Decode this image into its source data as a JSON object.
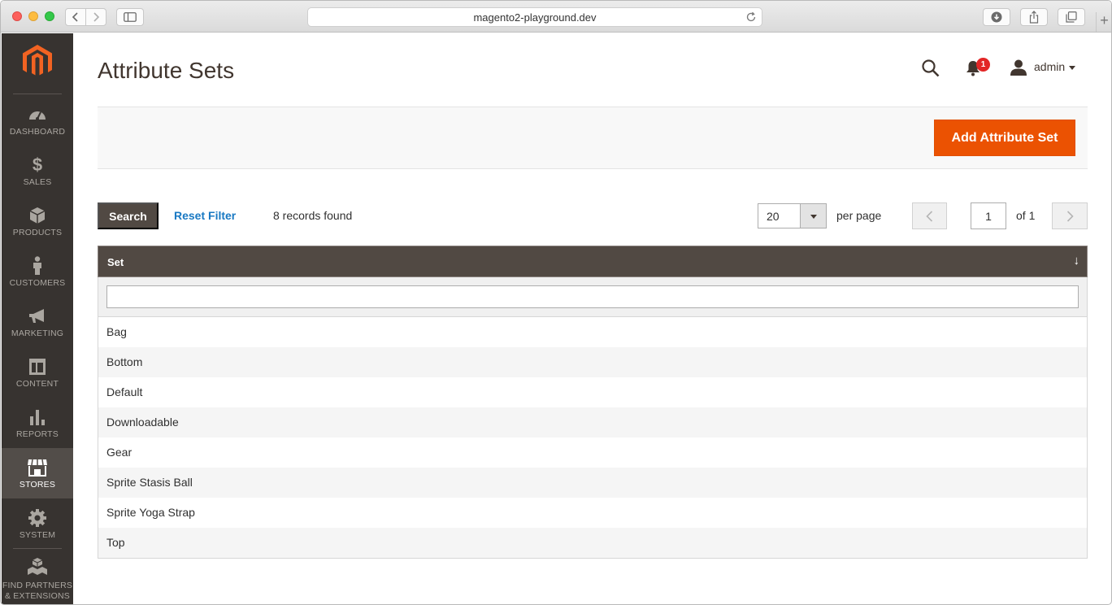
{
  "browser": {
    "url": "magento2-playground.dev"
  },
  "sidebar": {
    "items": [
      {
        "label": "DASHBOARD",
        "icon": "dashboard-icon"
      },
      {
        "label": "SALES",
        "icon": "dollar-icon"
      },
      {
        "label": "PRODUCTS",
        "icon": "cube-icon"
      },
      {
        "label": "CUSTOMERS",
        "icon": "person-icon"
      },
      {
        "label": "MARKETING",
        "icon": "megaphone-icon"
      },
      {
        "label": "CONTENT",
        "icon": "layout-icon"
      },
      {
        "label": "REPORTS",
        "icon": "bar-chart-icon"
      },
      {
        "label": "STORES",
        "icon": "storefront-icon",
        "active": true
      },
      {
        "label": "SYSTEM",
        "icon": "gear-icon"
      },
      {
        "label_line1": "FIND PARTNERS",
        "label_line2": "& EXTENSIONS",
        "icon": "boxes-icon"
      }
    ]
  },
  "header": {
    "title": "Attribute Sets",
    "notifications_count": "1",
    "user_name": "admin"
  },
  "actions": {
    "add_button": "Add Attribute Set"
  },
  "grid_controls": {
    "search_button": "Search",
    "reset_filter": "Reset Filter",
    "records_found": "8 records found",
    "per_page_value": "20",
    "per_page_label": "per page",
    "current_page": "1",
    "page_of": "of 1"
  },
  "grid": {
    "column_header": "Set",
    "sort_indicator": "↓",
    "filter_value": "",
    "rows": [
      "Bag",
      "Bottom",
      "Default",
      "Downloadable",
      "Gear",
      "Sprite Stasis Ball",
      "Sprite Yoga Strap",
      "Top"
    ]
  },
  "colors": {
    "accent": "#eb5202",
    "sidebar_bg": "#373330",
    "sidebar_active": "#524d49",
    "grid_header": "#514943",
    "link": "#1979c3"
  }
}
